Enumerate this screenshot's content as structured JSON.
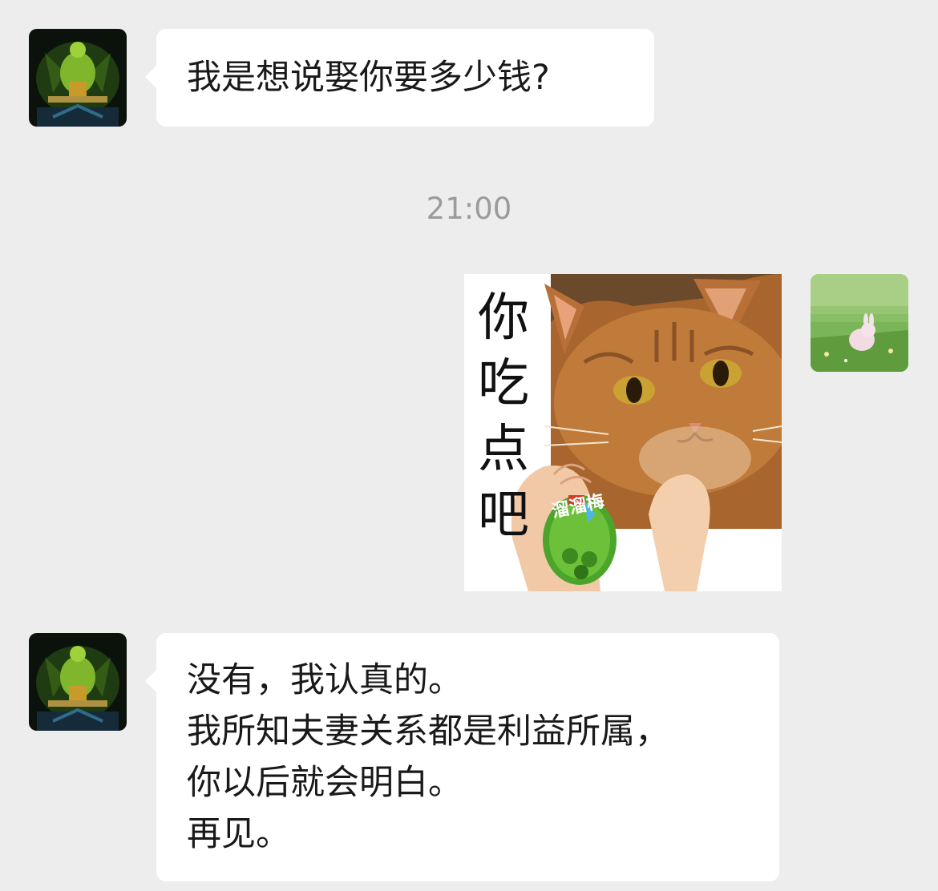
{
  "messages": [
    {
      "sender": "contact",
      "avatar_icon": "dark-green-character-avatar",
      "lines": [
        "我是想说娶你要多少钱?"
      ]
    },
    {
      "timestamp": "21:00"
    },
    {
      "sender": "self",
      "avatar_icon": "meadow-rabbit-avatar",
      "type": "sticker",
      "sticker": {
        "caption_chars": [
          "你",
          "吃",
          "点",
          "吧"
        ],
        "pack_label": "溜溜梅"
      }
    },
    {
      "sender": "contact",
      "avatar_icon": "dark-green-character-avatar",
      "lines": [
        "没有，我认真的。",
        "我所知夫妻关系都是利益所属，",
        "你以后就会明白。",
        "再见。"
      ]
    }
  ],
  "colors": {
    "background": "#ededed",
    "bubble": "#ffffff",
    "timestamp": "#9b9b9b"
  }
}
